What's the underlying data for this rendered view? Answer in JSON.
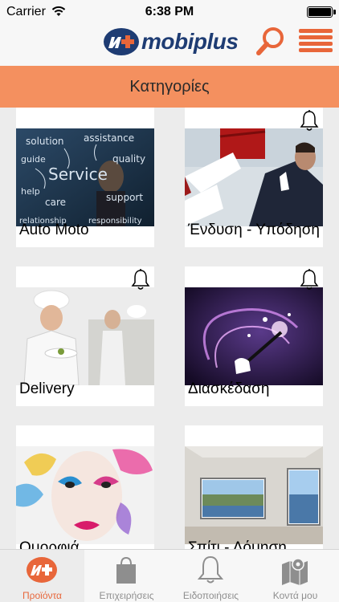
{
  "status_bar": {
    "carrier": "Carrier",
    "time": "6:38 PM"
  },
  "header": {
    "logo_text": "mobiplus",
    "search_icon": "search-icon",
    "menu_icon": "hamburger-menu-icon"
  },
  "section": {
    "title": "Κατηγορίες"
  },
  "categories": [
    {
      "label": "Auto Moto",
      "bell": false
    },
    {
      "label": "Ένδυση - Υπόδηση",
      "bell": true
    },
    {
      "label": "Delivery",
      "bell": true
    },
    {
      "label": "Διασκέδαση",
      "bell": true
    },
    {
      "label": "Ομορφιά",
      "bell": false
    },
    {
      "label": "Σπίτι - Δόμηση",
      "bell": false
    }
  ],
  "service_image_words": [
    "solution",
    "assistance",
    "guide",
    "quality",
    "Service",
    "help",
    "care",
    "support",
    "relationship",
    "responsibility"
  ],
  "tabs": [
    {
      "label": "Προϊόντα",
      "icon": "mobiplus-logo-icon",
      "active": true
    },
    {
      "label": "Επιχειρήσεις",
      "icon": "shopping-bag-icon",
      "active": false
    },
    {
      "label": "Ειδοποιήσεις",
      "icon": "bell-icon",
      "active": false
    },
    {
      "label": "Κοντά μου",
      "icon": "map-pin-icon",
      "active": false
    }
  ],
  "colors": {
    "accent": "#e8663a",
    "section_bar": "#f4905f",
    "logo_blue": "#1e3c73"
  }
}
